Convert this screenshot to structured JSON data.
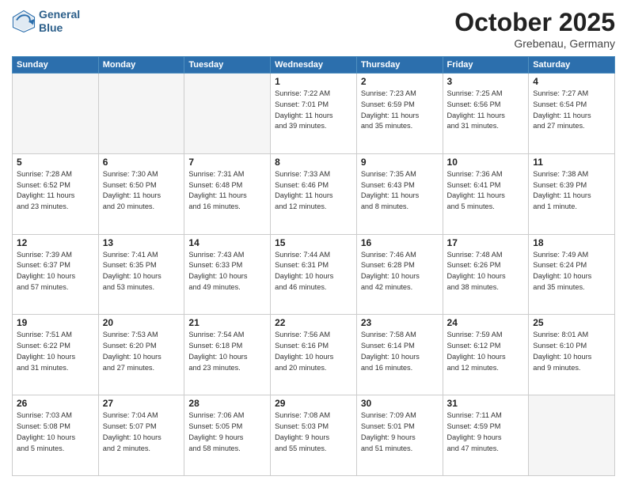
{
  "header": {
    "logo_line1": "General",
    "logo_line2": "Blue",
    "month": "October 2025",
    "location": "Grebenau, Germany"
  },
  "weekdays": [
    "Sunday",
    "Monday",
    "Tuesday",
    "Wednesday",
    "Thursday",
    "Friday",
    "Saturday"
  ],
  "weeks": [
    [
      {
        "day": "",
        "info": ""
      },
      {
        "day": "",
        "info": ""
      },
      {
        "day": "",
        "info": ""
      },
      {
        "day": "1",
        "info": "Sunrise: 7:22 AM\nSunset: 7:01 PM\nDaylight: 11 hours\nand 39 minutes."
      },
      {
        "day": "2",
        "info": "Sunrise: 7:23 AM\nSunset: 6:59 PM\nDaylight: 11 hours\nand 35 minutes."
      },
      {
        "day": "3",
        "info": "Sunrise: 7:25 AM\nSunset: 6:56 PM\nDaylight: 11 hours\nand 31 minutes."
      },
      {
        "day": "4",
        "info": "Sunrise: 7:27 AM\nSunset: 6:54 PM\nDaylight: 11 hours\nand 27 minutes."
      }
    ],
    [
      {
        "day": "5",
        "info": "Sunrise: 7:28 AM\nSunset: 6:52 PM\nDaylight: 11 hours\nand 23 minutes."
      },
      {
        "day": "6",
        "info": "Sunrise: 7:30 AM\nSunset: 6:50 PM\nDaylight: 11 hours\nand 20 minutes."
      },
      {
        "day": "7",
        "info": "Sunrise: 7:31 AM\nSunset: 6:48 PM\nDaylight: 11 hours\nand 16 minutes."
      },
      {
        "day": "8",
        "info": "Sunrise: 7:33 AM\nSunset: 6:46 PM\nDaylight: 11 hours\nand 12 minutes."
      },
      {
        "day": "9",
        "info": "Sunrise: 7:35 AM\nSunset: 6:43 PM\nDaylight: 11 hours\nand 8 minutes."
      },
      {
        "day": "10",
        "info": "Sunrise: 7:36 AM\nSunset: 6:41 PM\nDaylight: 11 hours\nand 5 minutes."
      },
      {
        "day": "11",
        "info": "Sunrise: 7:38 AM\nSunset: 6:39 PM\nDaylight: 11 hours\nand 1 minute."
      }
    ],
    [
      {
        "day": "12",
        "info": "Sunrise: 7:39 AM\nSunset: 6:37 PM\nDaylight: 10 hours\nand 57 minutes."
      },
      {
        "day": "13",
        "info": "Sunrise: 7:41 AM\nSunset: 6:35 PM\nDaylight: 10 hours\nand 53 minutes."
      },
      {
        "day": "14",
        "info": "Sunrise: 7:43 AM\nSunset: 6:33 PM\nDaylight: 10 hours\nand 49 minutes."
      },
      {
        "day": "15",
        "info": "Sunrise: 7:44 AM\nSunset: 6:31 PM\nDaylight: 10 hours\nand 46 minutes."
      },
      {
        "day": "16",
        "info": "Sunrise: 7:46 AM\nSunset: 6:28 PM\nDaylight: 10 hours\nand 42 minutes."
      },
      {
        "day": "17",
        "info": "Sunrise: 7:48 AM\nSunset: 6:26 PM\nDaylight: 10 hours\nand 38 minutes."
      },
      {
        "day": "18",
        "info": "Sunrise: 7:49 AM\nSunset: 6:24 PM\nDaylight: 10 hours\nand 35 minutes."
      }
    ],
    [
      {
        "day": "19",
        "info": "Sunrise: 7:51 AM\nSunset: 6:22 PM\nDaylight: 10 hours\nand 31 minutes."
      },
      {
        "day": "20",
        "info": "Sunrise: 7:53 AM\nSunset: 6:20 PM\nDaylight: 10 hours\nand 27 minutes."
      },
      {
        "day": "21",
        "info": "Sunrise: 7:54 AM\nSunset: 6:18 PM\nDaylight: 10 hours\nand 23 minutes."
      },
      {
        "day": "22",
        "info": "Sunrise: 7:56 AM\nSunset: 6:16 PM\nDaylight: 10 hours\nand 20 minutes."
      },
      {
        "day": "23",
        "info": "Sunrise: 7:58 AM\nSunset: 6:14 PM\nDaylight: 10 hours\nand 16 minutes."
      },
      {
        "day": "24",
        "info": "Sunrise: 7:59 AM\nSunset: 6:12 PM\nDaylight: 10 hours\nand 12 minutes."
      },
      {
        "day": "25",
        "info": "Sunrise: 8:01 AM\nSunset: 6:10 PM\nDaylight: 10 hours\nand 9 minutes."
      }
    ],
    [
      {
        "day": "26",
        "info": "Sunrise: 7:03 AM\nSunset: 5:08 PM\nDaylight: 10 hours\nand 5 minutes."
      },
      {
        "day": "27",
        "info": "Sunrise: 7:04 AM\nSunset: 5:07 PM\nDaylight: 10 hours\nand 2 minutes."
      },
      {
        "day": "28",
        "info": "Sunrise: 7:06 AM\nSunset: 5:05 PM\nDaylight: 9 hours\nand 58 minutes."
      },
      {
        "day": "29",
        "info": "Sunrise: 7:08 AM\nSunset: 5:03 PM\nDaylight: 9 hours\nand 55 minutes."
      },
      {
        "day": "30",
        "info": "Sunrise: 7:09 AM\nSunset: 5:01 PM\nDaylight: 9 hours\nand 51 minutes."
      },
      {
        "day": "31",
        "info": "Sunrise: 7:11 AM\nSunset: 4:59 PM\nDaylight: 9 hours\nand 47 minutes."
      },
      {
        "day": "",
        "info": ""
      }
    ]
  ]
}
